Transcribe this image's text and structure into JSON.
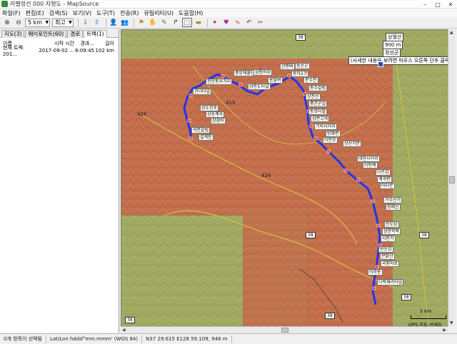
{
  "window": {
    "title": "라벨정선 000 지형도 - MapSource"
  },
  "menu": [
    "파일(F)",
    "편집(E)",
    "검색(S)",
    "보기(V)",
    "도구(T)",
    "전송(R)",
    "유틸리티(U)",
    "도움말(H)"
  ],
  "toolbar": {
    "zoom_value": "5 km",
    "detail_value": "최고"
  },
  "left_panel": {
    "tabs": [
      "지도(3)",
      "웨이포인트(60)",
      "경로",
      "트랙(1)"
    ],
    "active_tab_index": 3,
    "columns": {
      "name": "이름",
      "start": "시작 시간",
      "time": "경과...",
      "dist": "길이"
    },
    "rows": [
      {
        "name": "현재 트랙: 201...",
        "start": "2017-09-02 ...",
        "time": "8:09:45",
        "dist": "102 km"
      }
    ]
  },
  "map": {
    "highlight_labels": {
      "peak_name": "상월산",
      "elevation": "900 m",
      "suffix": "정선군",
      "info": "(사세한 내용을 보려면 마우스 오른쪽 단추 클릭)"
    },
    "waypoints": [
      "중앙채물단",
      "삼통바위",
      "천운동사거리",
      "간판벼",
      "동산군",
      "동아2코",
      "용팔벼",
      "상한도터널",
      "분수천",
      "동수갈림",
      "건너터널",
      "상천산",
      "중간군실",
      "상도진로",
      "상승계곡",
      "동로터벌",
      "상삼바",
      "삼권고개",
      "석문갈림",
      "기의사거리",
      "설계천",
      "방화변",
      "이안부",
      "상산거분",
      "대한사거리",
      "미탕배",
      "다르감",
      "계곡변",
      "마터분",
      "거수산거",
      "장례신",
      "인도당",
      "상한학목",
      "사한가",
      "반운감",
      "큰밝산",
      "국뭔자로",
      "이라동",
      "다락재리터널"
    ],
    "mtn_labels": [
      "424",
      "424",
      "415"
    ],
    "road_shields": [
      "38",
      "38",
      "38",
      "38",
      "38",
      "38"
    ],
    "scale": "5 km",
    "copyright": "GPS 지도 상세도"
  },
  "statusbar": {
    "selection": "0개 항목이 선택됨",
    "format": "Lat/Lon hddd°mm.mmm' (WGS 84)",
    "coords": "N37 29.615 E128 59.109, 946 m"
  },
  "colors": {
    "track": "#2233ee",
    "shaded_area": "#c46f4e",
    "terrain": "#9fa85c"
  }
}
